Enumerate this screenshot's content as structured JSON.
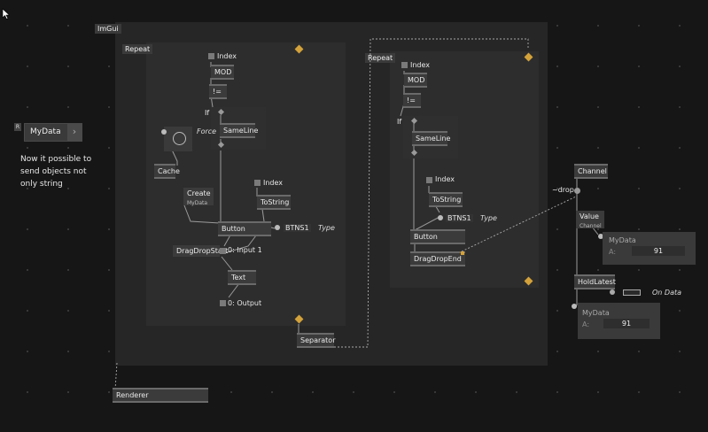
{
  "regions": {
    "imgui": "ImGui",
    "repeat_left": "Repeat",
    "repeat_right": "Repeat"
  },
  "left": {
    "index": "Index",
    "mod": "MOD",
    "neq": "!=",
    "if": "If",
    "sameline": "SameLine",
    "force": "Force",
    "cache": "Cache",
    "create": "Create",
    "create_sub": "MyData",
    "index2": "Index",
    "tostring": "ToString",
    "button": "Button",
    "btns1": "BTNS1",
    "type": "Type",
    "dragdropstart": "DragDropStart",
    "input1": "0: Input 1",
    "text": "Text",
    "output": "0: Output",
    "separator": "Separator"
  },
  "right": {
    "index": "Index",
    "mod": "MOD",
    "neq": "!=",
    "if": "If",
    "sameline": "SameLine",
    "index2": "Index",
    "tostring": "ToString",
    "btns1": "BTNS1",
    "type": "Type",
    "button": "Button",
    "dragdropend": "DragDropEnd"
  },
  "side": {
    "r_badge": "R",
    "mydata": "MyData",
    "chevron": "›",
    "note": [
      "Now it possible to",
      "send objects not",
      "only string"
    ],
    "channel": "Channel",
    "drop": "~drop",
    "value": "Value",
    "value_sub": "Channel",
    "mydata_box1_title": "MyData",
    "mydata_box1_a": "A:",
    "mydata_box1_val": "91",
    "holdlatest": "HoldLatest",
    "ondata": "On Data",
    "mydata_box2_title": "MyData",
    "mydata_box2_a": "A:",
    "mydata_box2_val": "91",
    "renderer": "Renderer"
  },
  "colors": {
    "background": "#161616",
    "region": "#262626",
    "node": "#3b3b3b",
    "accent": "#d4a23a"
  }
}
